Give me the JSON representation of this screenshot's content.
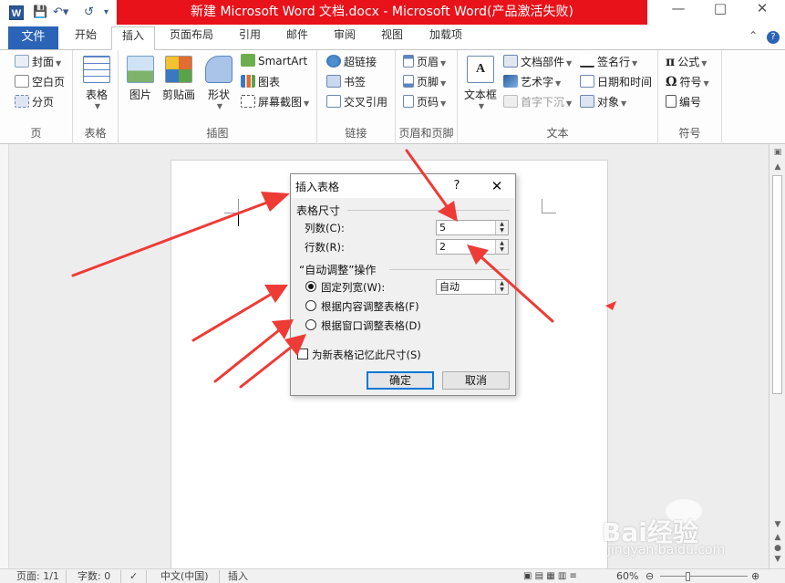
{
  "titlebar": {
    "title": "新建 Microsoft Word 文档.docx - Microsoft Word(产品激活失败)",
    "app_icon": "W",
    "minimize": "—",
    "maximize": "□",
    "close": "✕"
  },
  "tabs": {
    "file": "文件",
    "items": [
      "开始",
      "插入",
      "页面布局",
      "引用",
      "邮件",
      "审阅",
      "视图",
      "加载项"
    ],
    "active": "插入"
  },
  "ribbon": {
    "pages": {
      "label": "页",
      "cover": "封面",
      "blank": "空白页",
      "break": "分页"
    },
    "tables": {
      "label": "表格",
      "table": "表格"
    },
    "illustrations": {
      "label": "插图",
      "picture": "图片",
      "clipart": "剪贴画",
      "shapes": "形状",
      "smartart": "SmartArt",
      "chart": "图表",
      "screenshot": "屏幕截图"
    },
    "links": {
      "label": "链接",
      "hyperlink": "超链接",
      "bookmark": "书签",
      "crossref": "交叉引用"
    },
    "header_footer": {
      "label": "页眉和页脚",
      "header": "页眉",
      "footer": "页脚",
      "page_number": "页码"
    },
    "text": {
      "label": "文本",
      "textbox": "文本框",
      "quickparts": "文档部件",
      "wordart": "艺术字",
      "dropcap": "首字下沉",
      "signature": "签名行",
      "datetime": "日期和时间",
      "object": "对象"
    },
    "symbols": {
      "label": "符号",
      "equation": "公式",
      "symbol": "符号",
      "number": "编号"
    }
  },
  "dialog": {
    "title": "插入表格",
    "help": "?",
    "close": "✕",
    "size_section": "表格尺寸",
    "columns_label": "列数(C):",
    "columns_value": "5",
    "rows_label": "行数(R):",
    "rows_value": "2",
    "autofit_section": "“自动调整”操作",
    "fixed_width_label": "固定列宽(W):",
    "fixed_width_value": "自动",
    "autofit_content_label": "根据内容调整表格(F)",
    "autofit_window_label": "根据窗口调整表格(D)",
    "remember_label": "为新表格记忆此尺寸(S)",
    "ok": "确定",
    "cancel": "取消"
  },
  "statusbar": {
    "page": "页面: 1/1",
    "words": "字数: 0",
    "language": "中文(中国)",
    "mode": "插入",
    "zoom": "60%"
  },
  "watermark": {
    "brand": "Bai经验",
    "url": "jingyan.baidu.com"
  },
  "colors": {
    "title_band": "#e8121a",
    "file_tab": "#2b63b7",
    "arrow": "#ee3b36"
  }
}
